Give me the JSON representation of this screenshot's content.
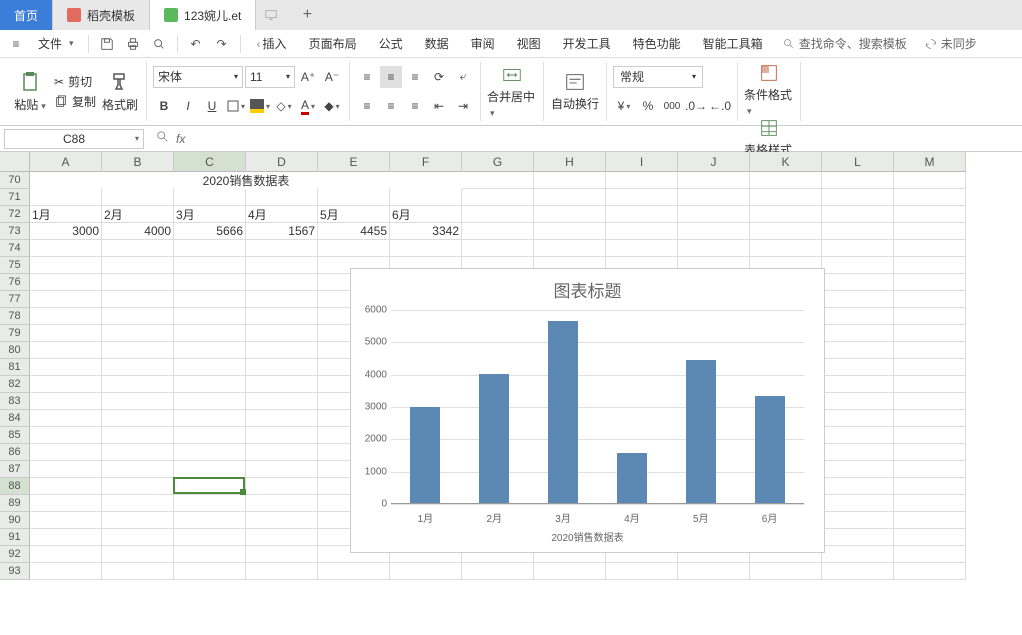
{
  "tabs": {
    "home": "首页",
    "template": "稻壳模板",
    "doc": "123婉儿.et"
  },
  "menu": {
    "file": "文件",
    "insert": "插入",
    "layout": "页面布局",
    "formula": "公式",
    "data": "数据",
    "review": "审阅",
    "view": "视图",
    "dev": "开发工具",
    "special": "特色功能",
    "smart": "智能工具箱",
    "search": "查找命令、搜索模板",
    "sync": "未同步"
  },
  "ribbon": {
    "paste": "粘贴",
    "cut": "剪切",
    "copy": "复制",
    "format_painter": "格式刷",
    "font": "宋体",
    "font_size": "11",
    "merge": "合并居中",
    "wrap": "自动换行",
    "number_format": "常规",
    "cond_fmt": "条件格式",
    "table_style": "表格样式"
  },
  "formula_bar": {
    "name_box": "C88"
  },
  "sheet": {
    "title": "2020销售数据表",
    "cols": [
      "A",
      "B",
      "C",
      "D",
      "E",
      "F",
      "G",
      "H",
      "I",
      "J",
      "K",
      "L",
      "M"
    ],
    "start_row": 70,
    "row_count": 24,
    "months": [
      "1月",
      "2月",
      "3月",
      "4月",
      "5月",
      "6月"
    ],
    "values": [
      "3000",
      "4000",
      "5666",
      "1567",
      "4455",
      "3342"
    ],
    "selected_cell": {
      "col": 2,
      "row": 88
    }
  },
  "chart_data": {
    "type": "bar",
    "title": "图表标题",
    "categories": [
      "1月",
      "2月",
      "3月",
      "4月",
      "5月",
      "6月"
    ],
    "values": [
      3000,
      4000,
      5666,
      1567,
      4455,
      3342
    ],
    "xlabel": "2020销售数据表",
    "ylabel": "",
    "ylim": [
      0,
      6000
    ],
    "y_ticks": [
      0,
      1000,
      2000,
      3000,
      4000,
      5000,
      6000
    ]
  }
}
